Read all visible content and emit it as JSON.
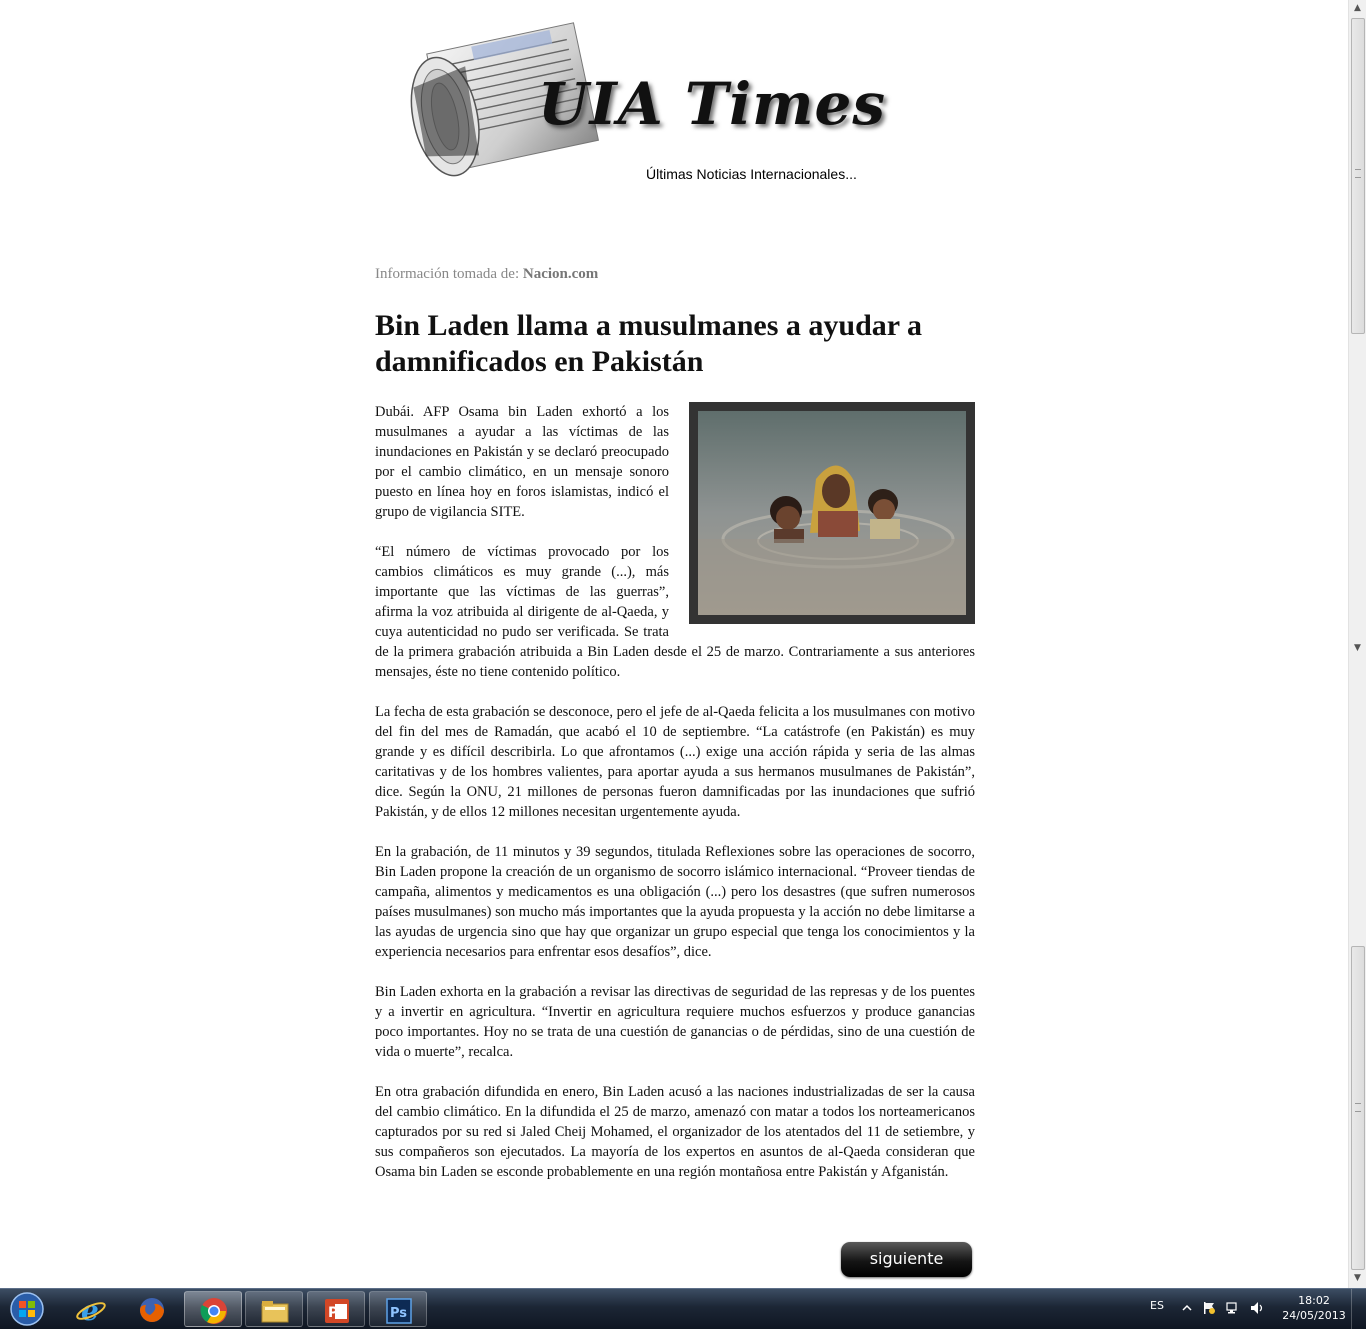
{
  "masthead": {
    "title": "UIA Times",
    "tagline": "Últimas Noticias Internacionales..."
  },
  "article": {
    "source_prefix": "Información tomada de:",
    "source_name": "Nacion.com",
    "headline": "Bin Laden llama a musulmanes a ayudar a damnificados en Pakistán",
    "paragraphs": [
      "Dubái. AFP Osama bin Laden exhortó a los musulmanes a ayudar a las víctimas de las inundaciones en Pakistán y se declaró preocupado por el cambio climático, en un mensaje sonoro puesto en línea hoy en foros islamistas, indicó el grupo de vigilancia SITE.",
      "“El número de víctimas provocado por los cambios climáticos es muy grande (...), más importante que las víctimas de las guerras”, afirma la voz atribuida al dirigente de al-Qaeda, y cuya autenticidad no pudo ser verificada. Se trata de la primera grabación atribuida a Bin Laden desde el 25 de marzo. Contrariamente a sus anteriores mensajes, éste no tiene contenido político.",
      "La fecha de esta grabación se desconoce, pero el jefe de al-Qaeda felicita a los musulmanes con motivo del fin del mes de Ramadán, que acabó el 10 de septiembre. “La catástrofe (en Pakistán) es muy grande y es difícil describirla. Lo que afrontamos (...) exige una acción rápida y seria de las almas caritativas y de los hombres valientes, para aportar ayuda a sus hermanos musulmanes de Pakistán”, dice. Según la ONU, 21 millones de personas fueron damnificadas por las inundaciones que sufrió Pakistán, y de ellos 12 millones necesitan urgentemente ayuda.",
      "En la grabación, de 11 minutos y 39 segundos, titulada Reflexiones sobre las operaciones de socorro, Bin Laden propone la creación de un organismo de socorro islámico internacional. “Proveer tiendas de campaña, alimentos y medicamentos es una obligación (...) pero los desastres (que sufren numerosos países musulmanes) son mucho más importantes que la ayuda propuesta y la acción no debe limitarse a las ayudas de urgencia sino que hay que organizar un grupo especial que tenga los conocimientos y la experiencia necesarios para enfrentar esos desafíos”, dice.",
      "Bin Laden exhorta en la grabación a revisar las directivas de seguridad de las represas y de los puentes y a invertir en agricultura. “Invertir en agricultura requiere muchos esfuerzos y produce ganancias poco importantes. Hoy no se trata de una cuestión de ganancias o de pérdidas, sino de una cuestión de vida o muerte”, recalca.",
      "En otra grabación difundida en enero, Bin Laden acusó a las naciones industrializadas de ser la causa del cambio climático. En la difundida el 25 de marzo, amenazó con matar a todos los norteamericanos capturados por su red si Jaled Cheij Mohamed, el organizador de los atentados del 11 de setiembre, y sus compañeros son ejecutados. La mayoría de los expertos en asuntos de al-Qaeda consideran que Osama bin Laden se esconde probablemente en una región montañosa entre Pakistán y Afganistán."
    ],
    "next_button": "siguiente"
  },
  "taskbar": {
    "apps": [
      {
        "name": "internet-explorer",
        "icon": "internet-explorer-icon"
      },
      {
        "name": "firefox",
        "icon": "firefox-icon"
      },
      {
        "name": "chrome",
        "icon": "chrome-icon"
      },
      {
        "name": "file-explorer",
        "icon": "folder-icon"
      },
      {
        "name": "powerpoint",
        "icon": "powerpoint-icon"
      },
      {
        "name": "photoshop",
        "icon": "photoshop-icon"
      }
    ],
    "language": "ES",
    "time": "18:02",
    "date": "24/05/2013"
  }
}
